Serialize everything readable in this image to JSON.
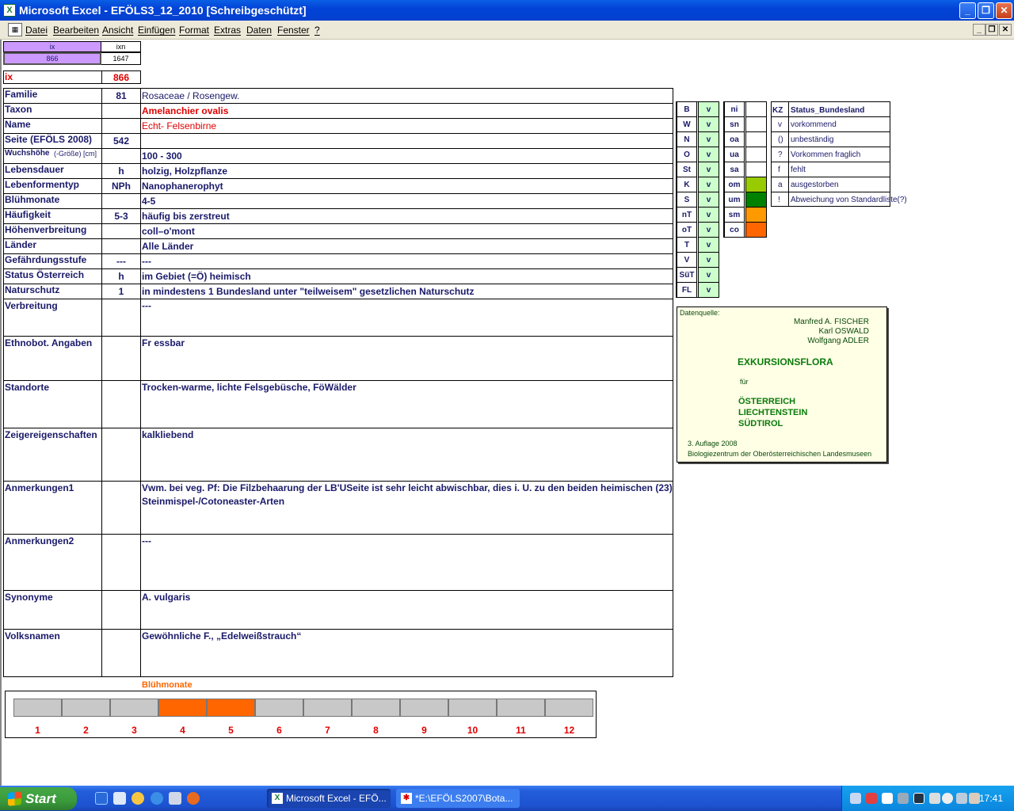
{
  "window": {
    "title": "Microsoft Excel - EFÖLS3_12_2010  [Schreibgeschützt]",
    "app_icon": "excel-icon"
  },
  "menu": {
    "items": [
      "Datei",
      "Bearbeiten",
      "Ansicht",
      "Einfügen",
      "Format",
      "Extras",
      "Daten",
      "Fenster",
      "?"
    ]
  },
  "top": {
    "ix_head": "ix",
    "ixn_head": "ixn",
    "ix_val": "866",
    "ixn_val": "1647",
    "ix_label": "ix",
    "ix_big": "866"
  },
  "rows": [
    {
      "label": "Familie",
      "code": "81",
      "value": "Rosaceae  /  Rosengew."
    },
    {
      "label": "Taxon",
      "code": "",
      "value": "Amelanchier ovalis"
    },
    {
      "label": "Name",
      "code": "",
      "value": "Echt- Felsenbirne"
    },
    {
      "label": "Seite (EFÖLS 2008)",
      "code": "542",
      "value": ""
    },
    {
      "label": "Wuchshöhe",
      "label_suffix": " (-Größe) [cm]",
      "code": "",
      "value": " 100 - 300"
    },
    {
      "label": "Lebensdauer",
      "code": "h",
      "value": "holzig, Holzpflanze"
    },
    {
      "label": "Lebenformentyp",
      "code": "NPh",
      "value": "Nanophanerophyt"
    },
    {
      "label": "Blühmonate",
      "code": "",
      "value": " 4-5"
    },
    {
      "label": "Häufigkeit",
      "code": "5-3",
      "value": "häufig bis zerstreut"
    },
    {
      "label": "Höhenverbreitung",
      "code": "",
      "value": "coll–o'mont"
    },
    {
      "label": "Länder",
      "code": "",
      "value": "Alle Länder"
    },
    {
      "label": "Gefährdungsstufe",
      "code": "---",
      "value": "  ---"
    },
    {
      "label": "Status Österreich",
      "code": "h",
      "value": "im Gebiet (=Ö) heimisch"
    },
    {
      "label": "Naturschutz",
      "code": "1",
      "value": "in mindestens 1 Bundesland unter \"teilweisem\" gesetzlichen Naturschutz"
    }
  ],
  "big_rows": [
    {
      "label": "Verbreitung",
      "value": " ---"
    },
    {
      "label": "Ethnobot. Angaben",
      "value": " Fr essbar"
    },
    {
      "label": "Standorte",
      "value": "Trocken-warme, lichte Felsgebüsche, FöWälder"
    },
    {
      "label": "Zeigereigenschaften",
      "value": "kalkliebend"
    },
    {
      "label": "Anmerkungen1",
      "value": "Vwm. bei veg. Pf: Die Filzbehaarung der LB'USeite ist sehr leicht abwischbar, dies i. U. zu den beiden heimischen (23)",
      "value2": "Steinmispel-/Cotoneaster-Arten"
    },
    {
      "label": "Anmerkungen2",
      "value": "---"
    },
    {
      "label": "Synonyme",
      "value": "A. vulgaris"
    },
    {
      "label": "Volksnamen",
      "value": "Gewöhnliche F., „Edelweißstrauch“"
    }
  ],
  "states": {
    "codes": [
      "B",
      "W",
      "N",
      "O",
      "St",
      "K",
      "S",
      "nT",
      "oT",
      "T",
      "V",
      "SüT",
      "FL"
    ],
    "mark": "v"
  },
  "zones": {
    "codes": [
      "ni",
      "sn",
      "oa",
      "ua",
      "sa",
      "om",
      "um",
      "sm",
      "co"
    ],
    "colors": [
      "",
      "",
      "",
      "",
      "",
      "#99cc00",
      "#008000",
      "#ff9900",
      "#ff6600"
    ]
  },
  "legend": {
    "head_kz": "KZ",
    "head_status": "Status_Bundesland",
    "entries": [
      {
        "kz": "v",
        "text": "vorkommend"
      },
      {
        "kz": "()",
        "text": "unbeständig"
      },
      {
        "kz": "?",
        "text": "Vorkommen fraglich"
      },
      {
        "kz": "f",
        "text": "fehlt"
      },
      {
        "kz": "a",
        "text": "ausgestorben"
      },
      {
        "kz": "!",
        "text": "Abweichung von Standardliste(?)"
      }
    ]
  },
  "source": {
    "head": "Datenquelle:",
    "authors": [
      "Manfred A. FISCHER",
      "Karl OSWALD",
      "Wolfgang ADLER"
    ],
    "title": "EXKURSIONSFLORA",
    "fuer": "für",
    "countries": [
      "ÖSTERREICH",
      "LIECHTENSTEIN",
      "SÜDTIROL"
    ],
    "edition": "3. Auflage 2008",
    "publisher": "Biologiezentrum der Oberösterreichischen Landesmuseen"
  },
  "bloom": {
    "title": "Blühmonate",
    "months": [
      "1",
      "2",
      "3",
      "4",
      "5",
      "6",
      "7",
      "8",
      "9",
      "10",
      "11",
      "12"
    ],
    "active": [
      4,
      5
    ]
  },
  "taskbar": {
    "start": "Start",
    "tasks": [
      "Microsoft Excel - EFÖ...",
      "*E:\\EFÖLS2007\\Bota..."
    ],
    "clock": "17:41"
  }
}
